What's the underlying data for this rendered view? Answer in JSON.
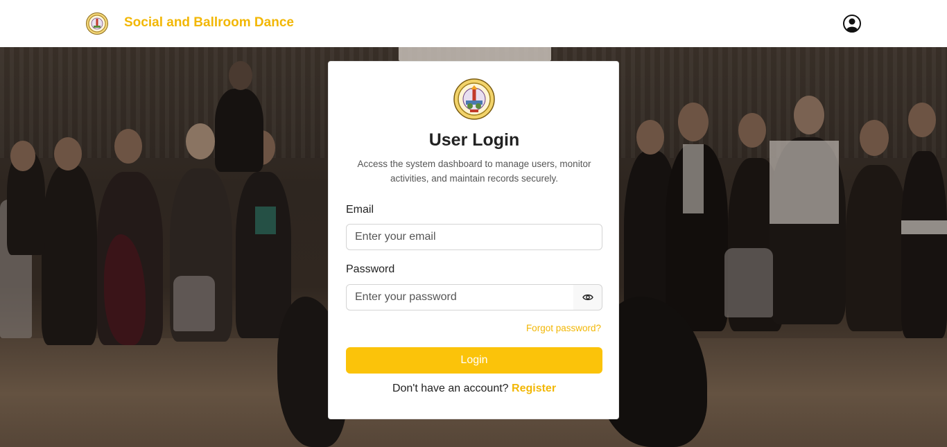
{
  "navbar": {
    "title": "Social and Ballroom Dance",
    "logo_icon": "college-seal-logo",
    "user_icon": "user-circle-icon"
  },
  "login_card": {
    "logo_icon": "college-seal-logo",
    "title": "User Login",
    "subtitle": "Access the system dashboard to manage users, monitor activities, and maintain records securely.",
    "email_label": "Email",
    "email_placeholder": "Enter your email",
    "email_value": "",
    "password_label": "Password",
    "password_placeholder": "Enter your password",
    "password_value": "",
    "show_password_icon": "eye-icon",
    "forgot_password": "Forgot password?",
    "login_button": "Login",
    "register_prompt": "Don't have an account?",
    "register_link": "Register"
  },
  "colors": {
    "accent": "#f2b705",
    "button": "#fbc30a",
    "navbar_bg": "#ffffff",
    "card_bg": "#ffffff"
  }
}
